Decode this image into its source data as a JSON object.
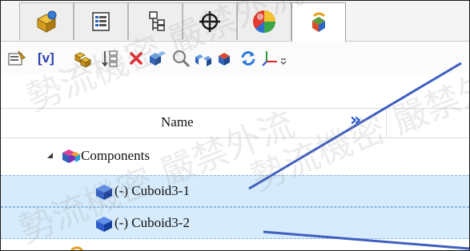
{
  "tabs": [
    {
      "icon": "feature-manager-icon"
    },
    {
      "icon": "property-manager-icon"
    },
    {
      "icon": "configuration-manager-icon"
    },
    {
      "icon": "dimxpert-icon"
    },
    {
      "icon": "display-manager-icon"
    },
    {
      "icon": "simulation-study-icon",
      "active": true
    }
  ],
  "toolbar": {
    "v_label": "[v]",
    "items": [
      "properties-icon",
      "variables-label",
      "components-icon",
      "sort-icon",
      "delete-icon",
      "move-components-icon",
      "zoom-to-selection-icon",
      "explode-icon",
      "cut-icon",
      "refresh-icon",
      "axis-icon",
      "overflow-icon"
    ]
  },
  "column": {
    "name_label": "Name",
    "more_label": "»"
  },
  "tree": {
    "root_label": "Components",
    "items": [
      {
        "label": "(-) Cuboid3-1",
        "selected": true
      },
      {
        "label": "(-) Cuboid3-2",
        "selected": true
      }
    ]
  },
  "watermark": {
    "text": "勢流機密 嚴禁外流"
  },
  "colors": {
    "selection": "#d6ebfb",
    "callout": "#3f5fbf",
    "accent": "#1f4fcf"
  }
}
